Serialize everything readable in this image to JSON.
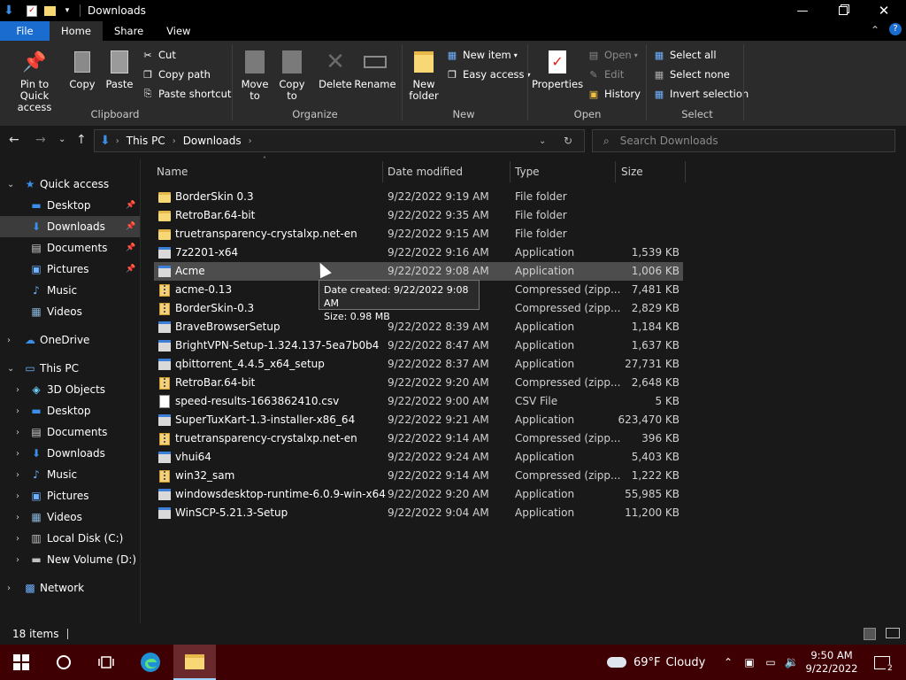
{
  "window": {
    "title": "Downloads"
  },
  "ribbon_tabs": [
    "File",
    "Home",
    "Share",
    "View"
  ],
  "ribbon": {
    "clipboard": {
      "pin": "Pin to Quick access",
      "copy": "Copy",
      "paste": "Paste",
      "cut": "Cut",
      "copy_path": "Copy path",
      "paste_shortcut": "Paste shortcut",
      "label": "Clipboard"
    },
    "organize": {
      "move_to": "Move to",
      "copy_to": "Copy to",
      "delete": "Delete",
      "rename": "Rename",
      "label": "Organize"
    },
    "new": {
      "new_folder": "New folder",
      "new_item": "New item",
      "easy_access": "Easy access",
      "label": "New"
    },
    "open": {
      "properties": "Properties",
      "open": "Open",
      "edit": "Edit",
      "history": "History",
      "label": "Open"
    },
    "select": {
      "select_all": "Select all",
      "select_none": "Select none",
      "invert": "Invert selection",
      "label": "Select"
    }
  },
  "address": {
    "segments": [
      "This PC",
      "Downloads"
    ],
    "search_placeholder": "Search Downloads"
  },
  "nav": [
    {
      "label": "Quick access",
      "icon": "star-icon",
      "level": 0,
      "expanded": true
    },
    {
      "label": "Desktop",
      "icon": "desktop-icon",
      "level": 1,
      "pinned": true
    },
    {
      "label": "Downloads",
      "icon": "download-icon",
      "level": 1,
      "pinned": true,
      "selected": true
    },
    {
      "label": "Documents",
      "icon": "document-icon",
      "level": 1,
      "pinned": true
    },
    {
      "label": "Pictures",
      "icon": "pictures-icon",
      "level": 1,
      "pinned": true
    },
    {
      "label": "Music",
      "icon": "music-icon",
      "level": 1
    },
    {
      "label": "Videos",
      "icon": "videos-icon",
      "level": 1
    },
    {
      "label": "OneDrive",
      "icon": "cloud-icon",
      "level": 0,
      "expanded": false
    },
    {
      "label": "This PC",
      "icon": "computer-icon",
      "level": 0,
      "expanded": true
    },
    {
      "label": "3D Objects",
      "icon": "cube-icon",
      "level": 1,
      "expandable": true
    },
    {
      "label": "Desktop",
      "icon": "desktop-icon",
      "level": 1,
      "expandable": true
    },
    {
      "label": "Documents",
      "icon": "document-icon",
      "level": 1,
      "expandable": true
    },
    {
      "label": "Downloads",
      "icon": "download-icon",
      "level": 1,
      "expandable": true
    },
    {
      "label": "Music",
      "icon": "music-icon",
      "level": 1,
      "expandable": true
    },
    {
      "label": "Pictures",
      "icon": "pictures-icon",
      "level": 1,
      "expandable": true
    },
    {
      "label": "Videos",
      "icon": "videos-icon",
      "level": 1,
      "expandable": true
    },
    {
      "label": "Local Disk (C:)",
      "icon": "disk-icon",
      "level": 1,
      "expandable": true
    },
    {
      "label": "New Volume (D:)",
      "icon": "drive-icon",
      "level": 1,
      "expandable": true
    },
    {
      "label": "Network",
      "icon": "network-icon",
      "level": 0,
      "expanded": false
    }
  ],
  "columns": [
    "Name",
    "Date modified",
    "Type",
    "Size"
  ],
  "files": [
    {
      "name": "BorderSkin 0.3",
      "date": "9/22/2022 9:19 AM",
      "type": "File folder",
      "size": "",
      "icon": "folder"
    },
    {
      "name": "RetroBar.64-bit",
      "date": "9/22/2022 9:35 AM",
      "type": "File folder",
      "size": "",
      "icon": "folder"
    },
    {
      "name": "truetransparency-crystalxp.net-en",
      "date": "9/22/2022 9:15 AM",
      "type": "File folder",
      "size": "",
      "icon": "folder"
    },
    {
      "name": "7z2201-x64",
      "date": "9/22/2022 9:16 AM",
      "type": "Application",
      "size": "1,539 KB",
      "icon": "app"
    },
    {
      "name": "Acme",
      "date": "9/22/2022 9:08 AM",
      "type": "Application",
      "size": "1,006 KB",
      "icon": "app",
      "hover": true
    },
    {
      "name": "acme-0.13",
      "date": "",
      "type": "Compressed (zipp...",
      "size": "7,481 KB",
      "icon": "zip"
    },
    {
      "name": "BorderSkin-0.3",
      "date": "",
      "type": "Compressed (zipp...",
      "size": "2,829 KB",
      "icon": "zip"
    },
    {
      "name": "BraveBrowserSetup",
      "date": "9/22/2022 8:39 AM",
      "type": "Application",
      "size": "1,184 KB",
      "icon": "app"
    },
    {
      "name": "BrightVPN-Setup-1.324.137-5ea7b0b4",
      "date": "9/22/2022 8:47 AM",
      "type": "Application",
      "size": "1,637 KB",
      "icon": "app"
    },
    {
      "name": "qbittorrent_4.4.5_x64_setup",
      "date": "9/22/2022 8:37 AM",
      "type": "Application",
      "size": "27,731 KB",
      "icon": "app"
    },
    {
      "name": "RetroBar.64-bit",
      "date": "9/22/2022 9:20 AM",
      "type": "Compressed (zipp...",
      "size": "2,648 KB",
      "icon": "zip"
    },
    {
      "name": "speed-results-1663862410.csv",
      "date": "9/22/2022 9:00 AM",
      "type": "CSV File",
      "size": "5 KB",
      "icon": "doc"
    },
    {
      "name": "SuperTuxKart-1.3-installer-x86_64",
      "date": "9/22/2022 9:21 AM",
      "type": "Application",
      "size": "623,470 KB",
      "icon": "app"
    },
    {
      "name": "truetransparency-crystalxp.net-en",
      "date": "9/22/2022 9:14 AM",
      "type": "Compressed (zipp...",
      "size": "396 KB",
      "icon": "zip"
    },
    {
      "name": "vhui64",
      "date": "9/22/2022 9:24 AM",
      "type": "Application",
      "size": "5,403 KB",
      "icon": "app"
    },
    {
      "name": "win32_sam",
      "date": "9/22/2022 9:14 AM",
      "type": "Compressed (zipp...",
      "size": "1,222 KB",
      "icon": "zip"
    },
    {
      "name": "windowsdesktop-runtime-6.0.9-win-x64",
      "date": "9/22/2022 9:20 AM",
      "type": "Application",
      "size": "55,985 KB",
      "icon": "app"
    },
    {
      "name": "WinSCP-5.21.3-Setup",
      "date": "9/22/2022 9:04 AM",
      "type": "Application",
      "size": "11,200 KB",
      "icon": "app"
    }
  ],
  "tooltip": {
    "line1": "Date created: 9/22/2022 9:08 AM",
    "line2": "Size: 0.98 MB"
  },
  "status": {
    "count": "18 items"
  },
  "taskbar": {
    "weather_temp": "69°F",
    "weather_text": "Cloudy",
    "time": "9:50 AM",
    "date": "9/22/2022",
    "notifications": "2"
  }
}
